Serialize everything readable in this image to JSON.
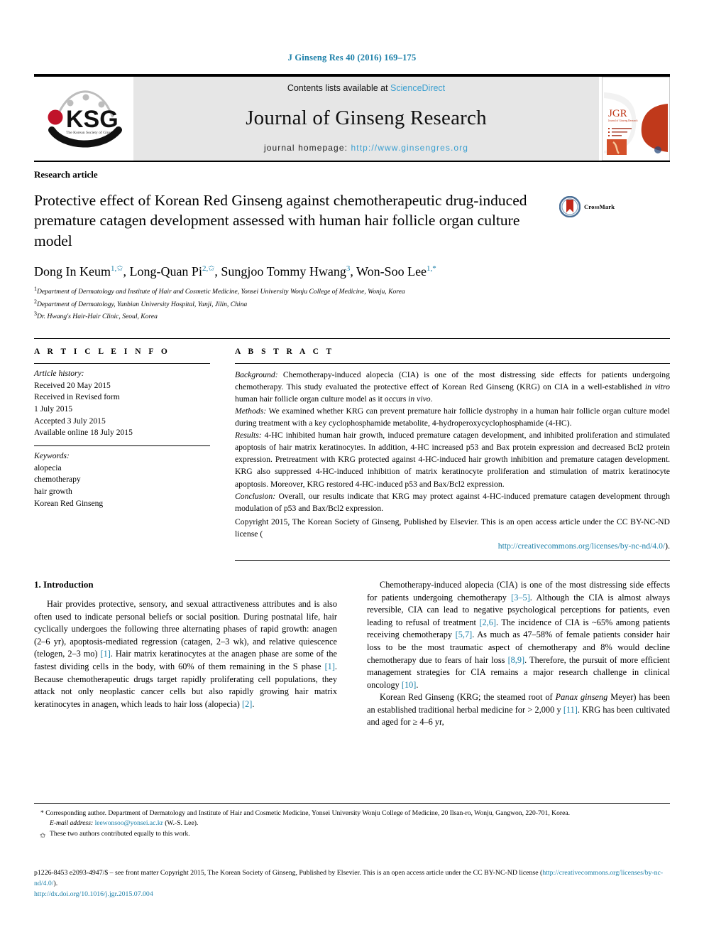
{
  "running_head": "J Ginseng Res 40 (2016) 169–175",
  "masthead": {
    "logo_alt": "KSG The Korean Society of Ginseng",
    "logo_text": "KSG",
    "logo_subtext": "The Korean Society of Ginseng",
    "contents_prefix": "Contents lists available at ",
    "contents_link": "ScienceDirect",
    "journal_title": "Journal of Ginseng Research",
    "homepage_prefix": "journal homepage: ",
    "homepage_url": "http://www.ginsengres.org",
    "cover_title": "JGR",
    "cover_subtitle": "Journal of Ginseng Research"
  },
  "article": {
    "type": "Research article",
    "title": "Protective effect of Korean Red Ginseng against chemotherapeutic drug-induced premature catagen development assessed with human hair follicle organ culture model",
    "crossmark_label": "CrossMark",
    "authors_html": "Dong In Keum, Long-Quan Pi, Sungjoo Tommy Hwang, Won-Soo Lee",
    "affiliations": [
      "Department of Dermatology and Institute of Hair and Cosmetic Medicine, Yonsei University Wonju College of Medicine, Wonju, Korea",
      "Department of Dermatology, Yanbian University Hospital, Yanji, Jilin, China",
      "Dr. Hwang's Hair-Hair Clinic, Seoul, Korea"
    ]
  },
  "article_info": {
    "heading": "A R T I C L E  I N F O",
    "history_label": "Article history:",
    "history": [
      "Received 20 May 2015",
      "Received in Revised form",
      "1 July 2015",
      "Accepted 3 July 2015",
      "Available online 18 July 2015"
    ],
    "keywords_label": "Keywords:",
    "keywords": [
      "alopecia",
      "chemotherapy",
      "hair growth",
      "Korean Red Ginseng"
    ]
  },
  "abstract": {
    "heading": "A B S T R A C T",
    "background_label": "Background:",
    "background_text": " Chemotherapy-induced alopecia (CIA) is one of the most distressing side effects for patients undergoing chemotherapy. This study evaluated the protective effect of Korean Red Ginseng (KRG) on CIA in a well-established in vitro human hair follicle organ culture model as it occurs in vivo.",
    "methods_label": "Methods:",
    "methods_text": " We examined whether KRG can prevent premature hair follicle dystrophy in a human hair follicle organ culture model during treatment with a key cyclophosphamide metabolite, 4-hydroperoxycyclophosphamide (4-HC).",
    "results_label": "Results:",
    "results_text": " 4-HC inhibited human hair growth, induced premature catagen development, and inhibited proliferation and stimulated apoptosis of hair matrix keratinocytes. In addition, 4-HC increased p53 and Bax protein expression and decreased Bcl2 protein expression. Pretreatment with KRG protected against 4-HC-induced hair growth inhibition and premature catagen development. KRG also suppressed 4-HC-induced inhibition of matrix keratinocyte proliferation and stimulation of matrix keratinocyte apoptosis. Moreover, KRG restored 4-HC-induced p53 and Bax/Bcl2 expression.",
    "conclusion_label": "Conclusion:",
    "conclusion_text": " Overall, our results indicate that KRG may protect against 4-HC-induced premature catagen development through modulation of p53 and Bax/Bcl2 expression.",
    "copyright_text": "Copyright 2015, The Korean Society of Ginseng, Published by Elsevier. This is an open access article under the CC BY-NC-ND license (",
    "copyright_license_url": "http://creativecommons.org/licenses/by-nc-nd/4.0/",
    "copyright_tail": ")."
  },
  "body": {
    "intro_heading": "1. Introduction",
    "left_para_1_a": "Hair provides protective, sensory, and sexual attractiveness attributes and is also often used to indicate personal beliefs or social position. During postnatal life, hair cyclically undergoes the following three alternating phases of rapid growth: anagen (2–6 yr), apoptosis-mediated regression (catagen, 2–3 wk), and relative quiescence (telogen, 2–3 mo) ",
    "left_ref_1a": "[1]",
    "left_para_1_b": ". Hair matrix keratinocytes at the anagen phase are some of the fastest dividing cells in the body, with 60% of them remaining in the S phase ",
    "left_ref_1b": "[1]",
    "left_para_1_c": ". Because chemotherapeutic drugs target rapidly proliferating cell populations, they attack not only neoplastic cancer cells but also rapidly growing hair matrix keratinocytes in anagen, which leads to hair loss (alopecia) ",
    "left_ref_1c": "[2]",
    "left_para_1_d": ".",
    "right_para_1_a": "Chemotherapy-induced alopecia (CIA) is one of the most distressing side effects for patients undergoing chemotherapy ",
    "right_ref_1a": "[3–5]",
    "right_para_1_b": ". Although the CIA is almost always reversible, CIA can lead to negative psychological perceptions for patients, even leading to refusal of treatment ",
    "right_ref_1b": "[2,6]",
    "right_para_1_c": ". The incidence of CIA is ~65% among patients receiving chemotherapy ",
    "right_ref_1c": "[5,7]",
    "right_para_1_d": ". As much as 47–58% of female patients consider hair loss to be the most traumatic aspect of chemotherapy and 8% would decline chemotherapy due to fears of hair loss ",
    "right_ref_1d": "[8,9]",
    "right_para_1_e": ". Therefore, the pursuit of more efficient management strategies for CIA remains a major research challenge in clinical oncology ",
    "right_ref_1e": "[10]",
    "right_para_1_f": ".",
    "right_para_2_a": "Korean Red Ginseng (KRG; the steamed root of Panax ginseng Meyer) has been an established traditional herbal medicine for > 2,000 y ",
    "right_ref_2a": "[11]",
    "right_para_2_b": ". KRG has been cultivated and aged for ≥ 4–6 yr,"
  },
  "footnotes": {
    "corresponding": "* Corresponding author. Department of Dermatology and Institute of Hair and Cosmetic Medicine, Yonsei University Wonju College of Medicine, 20 Ilsan-ro, Wonju, Gangwon, 220-701, Korea.",
    "email_label": "E-mail address:",
    "email": "leewonsoo@yonsei.ac.kr",
    "email_tail": " (W.-S. Lee).",
    "equal_contrib": "These two authors contributed equally to this work."
  },
  "footer": {
    "issn_text": "p1226-8453 e2093-4947/$ – see front matter Copyright 2015, The Korean Society of Ginseng, Published by Elsevier. This is an open access article under the CC BY-NC-ND license (",
    "license_url": "http://creativecommons.org/licenses/by-nc-nd/4.0/",
    "issn_tail": ").",
    "doi": "http://dx.doi.org/10.1016/j.jgr.2015.07.004"
  },
  "colors": {
    "link": "#1b7fa8",
    "masthead_bg": "#e6e6e6",
    "sciencedirect": "#3a9fd0"
  }
}
